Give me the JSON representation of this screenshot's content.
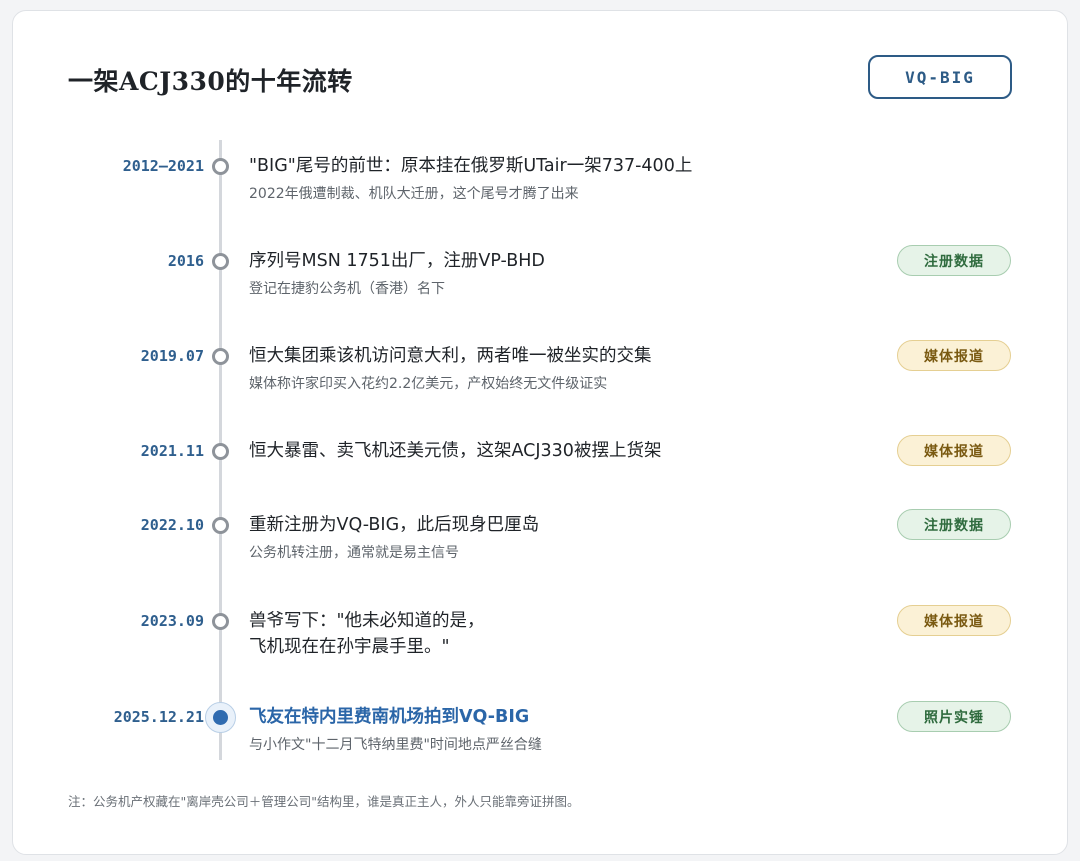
{
  "header": {
    "title": "一架ACJ330的十年流转",
    "registration": "VQ-BIG"
  },
  "events": [
    {
      "date": "2012–2021",
      "headline": "\"BIG\"尾号的前世：原本挂在俄罗斯UTair一架737-400上",
      "sub": "2022年俄遭制裁、机队大迁册，这个尾号才腾了出来"
    },
    {
      "date": "2016",
      "headline": "序列号MSN 1751出厂，注册VP-BHD",
      "sub": "登记在捷豹公务机（香港）名下",
      "tag": "注册数据"
    },
    {
      "date": "2019.07",
      "headline": "恒大集团乘该机访问意大利，两者唯一被坐实的交集",
      "sub": "媒体称许家印买入花约2.2亿美元，产权始终无文件级证实",
      "tag": "媒体报道"
    },
    {
      "date": "2021.11",
      "headline": "恒大暴雷、卖飞机还美元债，这架ACJ330被摆上货架",
      "tag": "媒体报道"
    },
    {
      "date": "2022.10",
      "headline": "重新注册为VQ-BIG，此后现身巴厘岛",
      "sub": "公务机转注册，通常就是易主信号",
      "tag": "注册数据"
    },
    {
      "date": "2023.09",
      "headline": "兽爷写下：\"他未必知道的是，",
      "headline2": "飞机现在在孙宇晨手里。\"",
      "tag": "媒体报道"
    },
    {
      "date": "2025.12.21",
      "headline": "飞友在特内里费南机场拍到VQ-BIG",
      "sub": "与小作文\"十二月飞特纳里费\"时间地点严丝合缝",
      "tag": "照片实锤"
    }
  ],
  "footnote": "注：公务机产权藏在\"离岸壳公司＋管理公司\"结构里，谁是真正主人，外人只能靠旁证拼图。",
  "colors": {
    "accent_blue": "#2f6bb0",
    "tag_green": "#2f6b3e",
    "tag_yellow": "#7a5a12"
  }
}
